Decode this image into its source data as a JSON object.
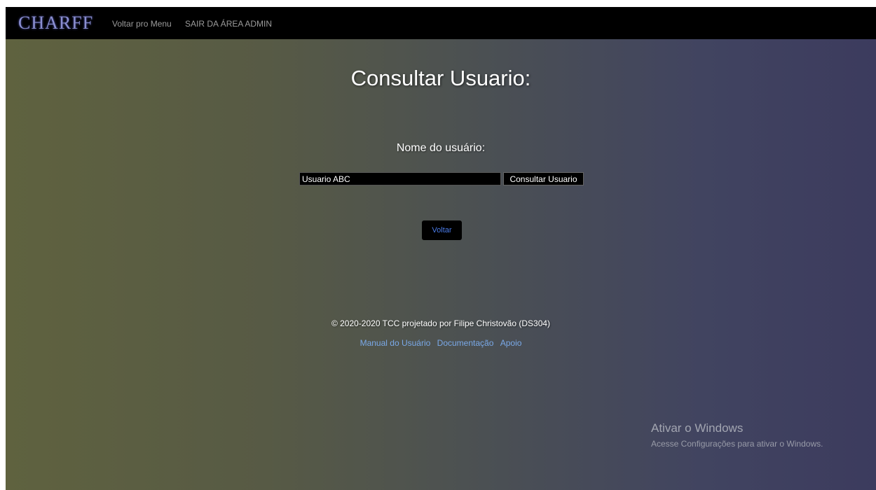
{
  "navbar": {
    "brand": "Charff",
    "links": [
      "Voltar pro Menu",
      "SAIR DA ÁREA ADMIN"
    ]
  },
  "page": {
    "title": "Consultar Usuario:"
  },
  "form": {
    "label": "Nome do usuário:",
    "input_value": "Usuario ABC",
    "submit_label": "Consultar Usuario"
  },
  "back_button": {
    "label": "Voltar"
  },
  "footer": {
    "copyright": "© 2020-2020 TCC projetado por Filipe Christovão (DS304)",
    "links": [
      "Manual do Usuário",
      "Documentação",
      "Apoio"
    ]
  },
  "windows_watermark": {
    "title": "Ativar o Windows",
    "subtitle": "Acesse Configurações para ativar o Windows."
  },
  "colors": {
    "navbar_bg": "#000000",
    "brand": "#8b8fd1",
    "link_blue": "#7aa9e8",
    "back_button_text": "#4a7be8",
    "gradient_left": "#5f623f",
    "gradient_right": "#3c3b5e"
  }
}
